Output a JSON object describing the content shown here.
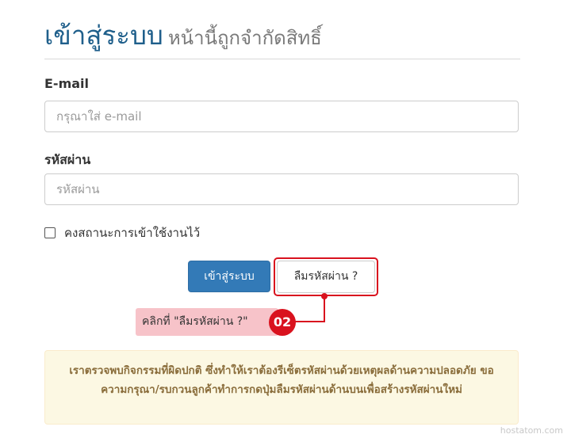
{
  "header": {
    "title": "เข้าสู่ระบบ",
    "subtitle": "หน้านี้ถูกจำกัดสิทธิ์"
  },
  "form": {
    "email_label": "E-mail",
    "email_placeholder": "กรุณาใส่ e-mail",
    "email_value": "",
    "password_label": "รหัสผ่าน",
    "password_placeholder": "รหัสผ่าน",
    "password_value": "",
    "remember_label": "คงสถานะการเข้าใช้งานไว้",
    "remember_checked": false
  },
  "actions": {
    "login_label": "เข้าสู่ระบบ",
    "forgot_label": "ลืมรหัสผ่าน ?"
  },
  "annotation": {
    "callout_text": "คลิกที่ \"ลืมรหัสผ่าน ?\"",
    "step_number": "02",
    "highlight_color": "#d9121e"
  },
  "alert": {
    "message": "เราตรวจพบกิจกรรมที่ผิดปกติ ซึ่งทำให้เราต้องรีเซ็ตรหัสผ่านด้วยเหตุผลด้านความปลอดภัย ขอความกรุณา/รบกวนลูกค้าทำการกดปุ่มลืมรหัสผ่านด้านบนเพื่อสร้างรหัสผ่านใหม่"
  },
  "watermark": "hostatom.com",
  "colors": {
    "primary": "#337ab7",
    "title": "#1f5f8b",
    "alert_bg": "#fcf8e3",
    "alert_text": "#8a6d3b"
  }
}
